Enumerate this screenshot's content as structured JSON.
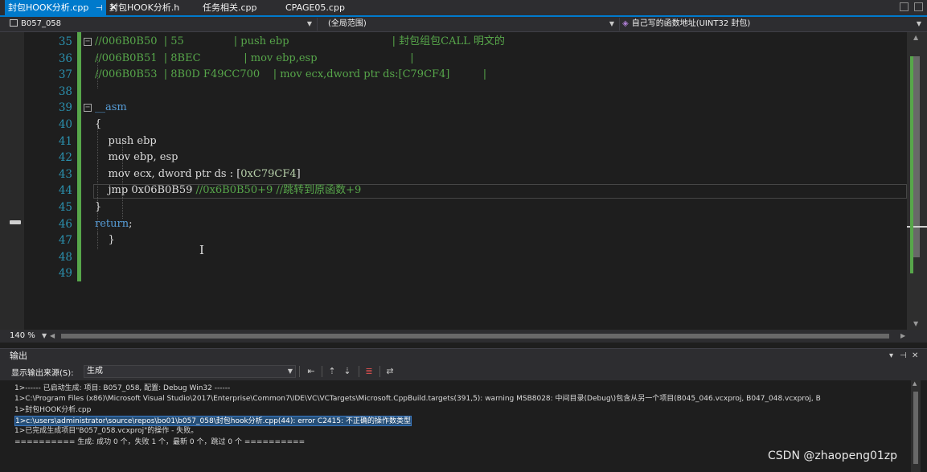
{
  "tabs": [
    {
      "label": "封包HOOK分析.cpp",
      "pin": "⊣",
      "close": "✕"
    },
    {
      "label": "封包HOOK分析.h"
    },
    {
      "label": "任务相关.cpp"
    },
    {
      "label": "CPAGE05.cpp"
    }
  ],
  "navbar": {
    "project": "B057_058",
    "scope": "(全局范围)",
    "function": "自己写的函数地址(UINT32 封包)"
  },
  "editor": {
    "lines": [
      {
        "num": "35",
        "fold": "⊟",
        "segs": [
          {
            "t": "//006B0B50  | 55               | push ebp                               | 封包组包CALL 明文的",
            "c": "comment"
          }
        ]
      },
      {
        "num": "36",
        "segs": [
          {
            "t": "//006B0B51  | 8BEC             | mov ebp,esp                            |",
            "c": "comment"
          }
        ]
      },
      {
        "num": "37",
        "segs": [
          {
            "t": "//006B0B53  | 8B0D F49CC700    | mov ecx,dword ptr ds:[C79CF4]          |",
            "c": "comment"
          }
        ]
      },
      {
        "num": "38",
        "segs": []
      },
      {
        "num": "39",
        "fold": "⊟",
        "segs": [
          {
            "t": "__asm",
            "c": "kw"
          }
        ]
      },
      {
        "num": "40",
        "segs": [
          {
            "t": "{",
            "c": "plain"
          }
        ]
      },
      {
        "num": "41",
        "segs": [
          {
            "t": "    push ebp",
            "c": "plain"
          }
        ]
      },
      {
        "num": "42",
        "segs": [
          {
            "t": "    mov ebp, esp",
            "c": "plain"
          }
        ]
      },
      {
        "num": "43",
        "segs": [
          {
            "t": "    mov ecx, dword ptr ds : [",
            "c": "plain"
          },
          {
            "t": "0xC79CF4",
            "c": "num"
          },
          {
            "t": "]",
            "c": "plain"
          }
        ]
      },
      {
        "num": "44",
        "segs": [
          {
            "t": "    jmp 0x06B0B59 ",
            "c": "plain"
          },
          {
            "t": "//0x6B0B50+9 //跳转到原函数+9",
            "c": "comment"
          }
        ]
      },
      {
        "num": "45",
        "segs": [
          {
            "t": "}",
            "c": "plain"
          }
        ]
      },
      {
        "num": "46",
        "segs": [
          {
            "t": "return",
            "c": "kw"
          },
          {
            "t": ";",
            "c": "plain"
          }
        ]
      },
      {
        "num": "47",
        "segs": [
          {
            "t": "    }",
            "c": "plain"
          }
        ]
      },
      {
        "num": "48",
        "segs": []
      },
      {
        "num": "49",
        "segs": []
      }
    ]
  },
  "zoom": "140 %",
  "output": {
    "title": "输出",
    "source_label": "显示输出来源(S):",
    "source_value": "生成",
    "lines": [
      {
        "text": "1>------ 已启动生成: 项目: B057_058, 配置: Debug Win32 ------"
      },
      {
        "text": "1>C:\\Program Files (x86)\\Microsoft Visual Studio\\2017\\Enterprise\\Common7\\IDE\\VC\\VCTargets\\Microsoft.CppBuild.targets(391,5): warning MSB8028: 中间目录(Debug\\)包含从另一个项目(B045_046.vcxproj, B047_048.vcxproj, B"
      },
      {
        "text": "1>封包HOOK分析.cpp"
      },
      {
        "text": "1>c:\\users\\administrator\\source\\repos\\bo01\\b057_058\\封包hook分析.cpp(44): error C2415: 不正确的操作数类型",
        "selected": true
      },
      {
        "text": "1>已完成生成项目\"B057_058.vcxproj\"的操作 - 失败。"
      },
      {
        "text": "========== 生成: 成功 0 个，失败 1 个，最新 0 个，跳过 0 个 =========="
      }
    ]
  },
  "watermark": "CSDN @zhaopeng01zp"
}
